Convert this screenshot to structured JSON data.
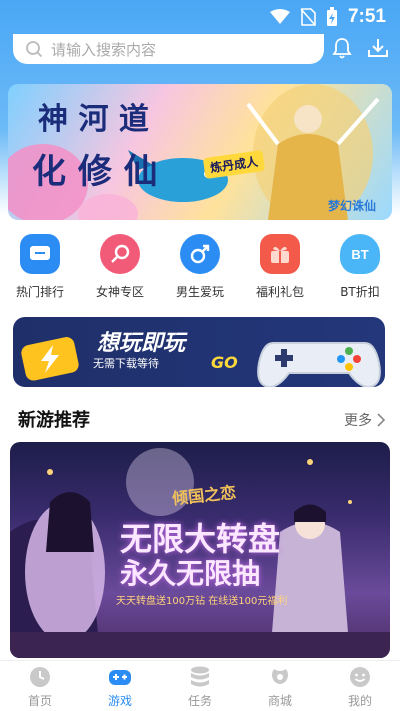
{
  "status_bar": {
    "time": "7:51"
  },
  "search": {
    "placeholder": "请输入搜索内容"
  },
  "header": {
    "icons": [
      "bell-icon",
      "download-icon"
    ]
  },
  "banner": {
    "line1": "神 河 道",
    "line2": "化 修 仙",
    "badge": "炼丹成人",
    "logo": "梦幻诛仙"
  },
  "quick_nav": [
    {
      "label": "热门排行",
      "icon": "chat-icon",
      "color": "#2b8df3"
    },
    {
      "label": "女神专区",
      "icon": "female-icon",
      "color": "#f25b78"
    },
    {
      "label": "男生爱玩",
      "icon": "male-icon",
      "color": "#2b8df3"
    },
    {
      "label": "福利礼包",
      "icon": "gift-icon",
      "color": "#f35a4a"
    },
    {
      "label": "BT折扣",
      "icon": "bt-icon",
      "color": "#4ab6f7"
    }
  ],
  "promo": {
    "title": "想玩即玩",
    "subtitle": "无需下载等待",
    "go": "GO"
  },
  "section": {
    "title": "新游推荐",
    "more": "更多"
  },
  "game_card": {
    "logo": "倾国之恋",
    "line1": "无限大转盘",
    "line2": "永久无限抽",
    "line3": "天天转盘送100万钻 在线送100元福利"
  },
  "tabbar": [
    {
      "label": "首页",
      "icon": "home-clock-icon",
      "active": false
    },
    {
      "label": "游戏",
      "icon": "gamepad-icon",
      "active": true
    },
    {
      "label": "任务",
      "icon": "database-icon",
      "active": false
    },
    {
      "label": "商城",
      "icon": "shop-icon",
      "active": false
    },
    {
      "label": "我的",
      "icon": "smile-icon",
      "active": false
    }
  ],
  "colors": {
    "accent": "#2b8df3",
    "header": "#4aa7f5"
  }
}
